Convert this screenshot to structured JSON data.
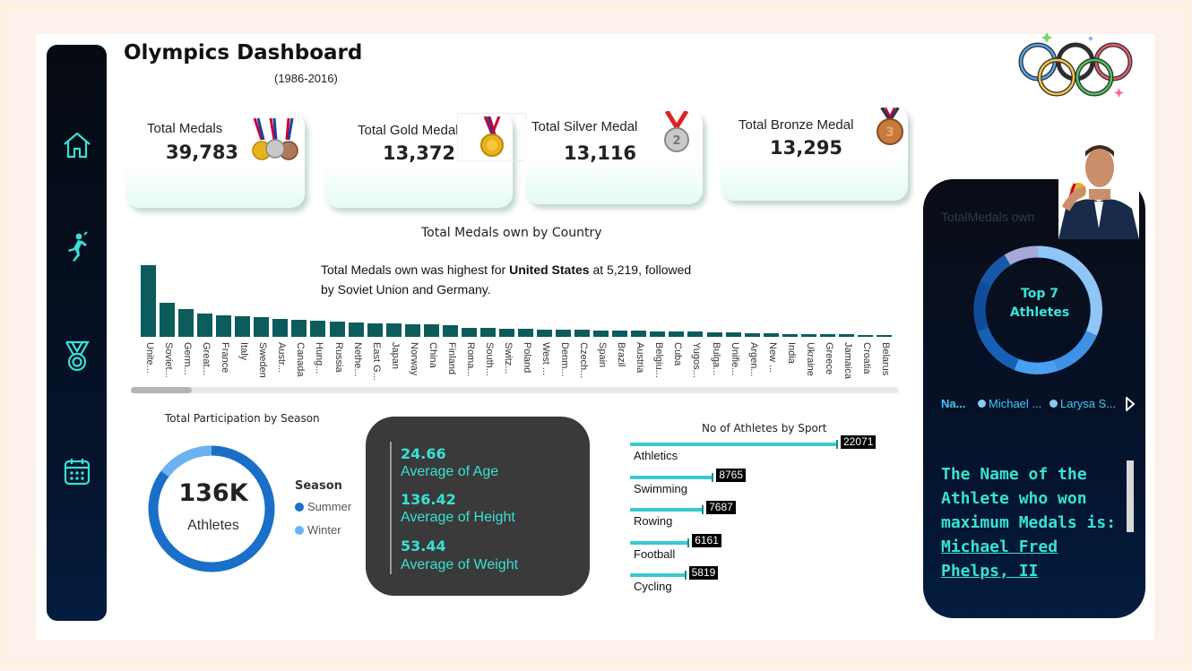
{
  "header": {
    "title": "Olympics Dashboard",
    "subtitle": "(1986-2016)"
  },
  "sidebar": {
    "items": [
      {
        "icon": "home-icon"
      },
      {
        "icon": "athlete-icon"
      },
      {
        "icon": "medal-icon"
      },
      {
        "icon": "calendar-icon"
      }
    ]
  },
  "cards": [
    {
      "label": "Total Medals",
      "value": "39,783",
      "icon": "medals-trio-icon"
    },
    {
      "label": "Total Gold Medal",
      "value": "13,372",
      "icon": "gold-medal-icon"
    },
    {
      "label": "Total Silver Medal",
      "value": "13,116",
      "icon": "silver-medal-icon"
    },
    {
      "label": "Total Bronze Medal",
      "value": "13,295",
      "icon": "bronze-medal-icon"
    }
  ],
  "country_chart": {
    "title": "Total Medals own by Country",
    "narrative_prefix": "Total Medals own was highest for ",
    "narrative_bold": "United States",
    "narrative_suffix": " at 5,219, followed by Soviet Union and Germany."
  },
  "season": {
    "title": "Total Participation by Season",
    "center_value": "136K",
    "center_label": "Athletes",
    "legend_title": "Season",
    "legend": [
      {
        "label": "Summer",
        "color": "#1a6fc8"
      },
      {
        "label": "Winter",
        "color": "#6cb2f0"
      }
    ]
  },
  "stats": [
    {
      "value": "24.66",
      "label": "Average of Age"
    },
    {
      "value": "136.42",
      "label": "Average of Height"
    },
    {
      "value": "53.44",
      "label": "Average of Weight"
    }
  ],
  "sport_chart": {
    "title": "No of Athletes by Sport",
    "items": [
      {
        "label": "Athletics",
        "value": "22071"
      },
      {
        "label": "Swimming",
        "value": "8765"
      },
      {
        "label": "Rowing",
        "value": "7687"
      },
      {
        "label": "Football",
        "value": "6161"
      },
      {
        "label": "Cycling",
        "value": "5819"
      }
    ]
  },
  "panel": {
    "title": "TotalMedals own",
    "donut_label_1": "Top 7",
    "donut_label_2": "Athletes",
    "legend_name": "Na...",
    "legend_items": [
      "Michael ...",
      "Larysa S..."
    ],
    "winner_text": "The Name of the Athlete who won maximum Medals is:",
    "winner_name": "Michael Fred Phelps, II"
  },
  "chart_data": {
    "type": "bar",
    "title": "Total Medals own by Country",
    "categories": [
      "Unite...",
      "Soviet...",
      "Germ...",
      "Great...",
      "France",
      "Italy",
      "Sweden",
      "Austr...",
      "Canada",
      "Hung...",
      "Russia",
      "Nethe...",
      "East G...",
      "Japan",
      "Norway",
      "China",
      "Finland",
      "Roma...",
      "South...",
      "Switz...",
      "Poland",
      "West ...",
      "Denm...",
      "Czech...",
      "Spain",
      "Brazil",
      "Austria",
      "Belgiu...",
      "Cuba",
      "Yugos...",
      "Bulga...",
      "Unifie...",
      "Argen...",
      "New ...",
      "India",
      "Ukraine",
      "Greece",
      "Jamaica",
      "Croatia",
      "Belarus"
    ],
    "values": [
      5219,
      2500,
      2050,
      1720,
      1550,
      1520,
      1460,
      1300,
      1250,
      1160,
      1080,
      1030,
      1000,
      950,
      940,
      930,
      880,
      650,
      630,
      610,
      570,
      550,
      530,
      510,
      480,
      470,
      440,
      420,
      400,
      380,
      350,
      320,
      280,
      250,
      220,
      200,
      190,
      170,
      160,
      150
    ],
    "ylim": [
      0,
      5219
    ],
    "grid": false,
    "narrative_highlight": "United States"
  }
}
